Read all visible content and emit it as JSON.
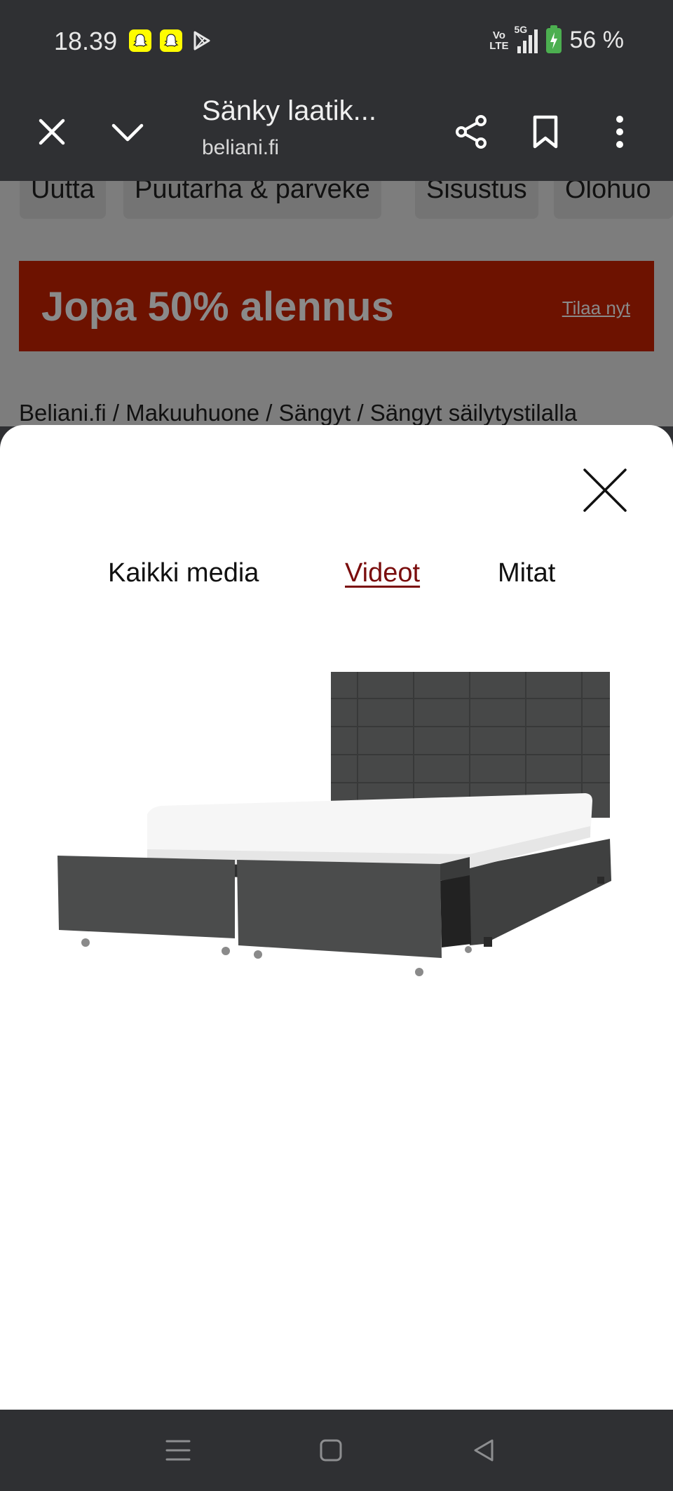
{
  "status_bar": {
    "time": "18.39",
    "notifications": [
      "snapchat-icon",
      "snapchat-icon",
      "play-store-icon"
    ],
    "network": "VoLTE",
    "network_label_top": "Vo",
    "network_label_bottom": "LTE",
    "signal": "5G",
    "battery": "56 %"
  },
  "toolbar": {
    "title": "Sänky laatik...",
    "url": "beliani.fi"
  },
  "categories": [
    "Uutta",
    "Puutarha & parveke",
    "Sisustus",
    "Olohuo"
  ],
  "promo": {
    "text": "Jopa 50% alennus",
    "link": "Tilaa nyt",
    "color": "#6d1200"
  },
  "breadcrumb": "Beliani.fi / Makuuhuone / Sängyt / Sängyt säilytystilalla",
  "modal": {
    "tabs": [
      {
        "label": "Kaikki media",
        "active": false
      },
      {
        "label": "Videot",
        "active": true
      },
      {
        "label": "Mitat",
        "active": false
      }
    ],
    "accent_color": "#7a0d0d"
  }
}
